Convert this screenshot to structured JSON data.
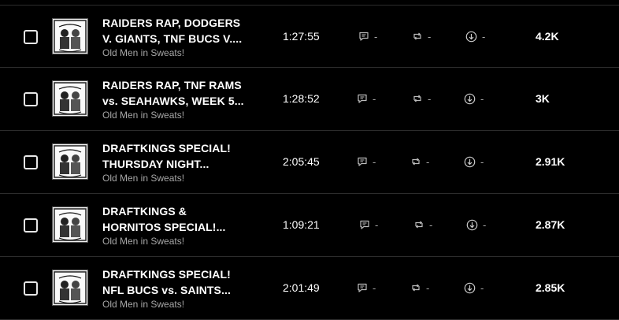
{
  "episodes": [
    {
      "title_line1": "RAIDERS RAP, DODGERS",
      "title_line2": "V. GIANTS, TNF BUCS V....",
      "author": "Old Men in Sweats!",
      "duration": "1:27:55",
      "comments": "-",
      "reposts": "-",
      "downloads": "-",
      "plays": "4.2K"
    },
    {
      "title_line1": "RAIDERS RAP, TNF RAMS",
      "title_line2": "vs. SEAHAWKS, WEEK 5...",
      "author": "Old Men in Sweats!",
      "duration": "1:28:52",
      "comments": "-",
      "reposts": "-",
      "downloads": "-",
      "plays": "3K"
    },
    {
      "title_line1": "DRAFTKINGS SPECIAL!",
      "title_line2": "THURSDAY NIGHT...",
      "author": "Old Men in Sweats!",
      "duration": "2:05:45",
      "comments": "-",
      "reposts": "-",
      "downloads": "-",
      "plays": "2.91K"
    },
    {
      "title_line1": "DRAFTKINGS &",
      "title_line2": "HORNITOS SPECIAL!...",
      "author": "Old Men in Sweats!",
      "duration": "1:09:21",
      "comments": "-",
      "reposts": "-",
      "downloads": "-",
      "plays": "2.87K"
    },
    {
      "title_line1": "DRAFTKINGS SPECIAL!",
      "title_line2": "NFL BUCS vs. SAINTS...",
      "author": "Old Men in Sweats!",
      "duration": "2:01:49",
      "comments": "-",
      "reposts": "-",
      "downloads": "-",
      "plays": "2.85K"
    }
  ],
  "icons": {
    "checkbox": "checkbox-icon",
    "comment": "comment-icon",
    "repost": "repost-icon",
    "download": "download-icon",
    "thumbnail": "podcast-cover-art"
  },
  "colors": {
    "background": "#000000",
    "text_primary": "#ffffff",
    "text_secondary": "#a7a7a7",
    "divider": "#2c2c2c"
  }
}
